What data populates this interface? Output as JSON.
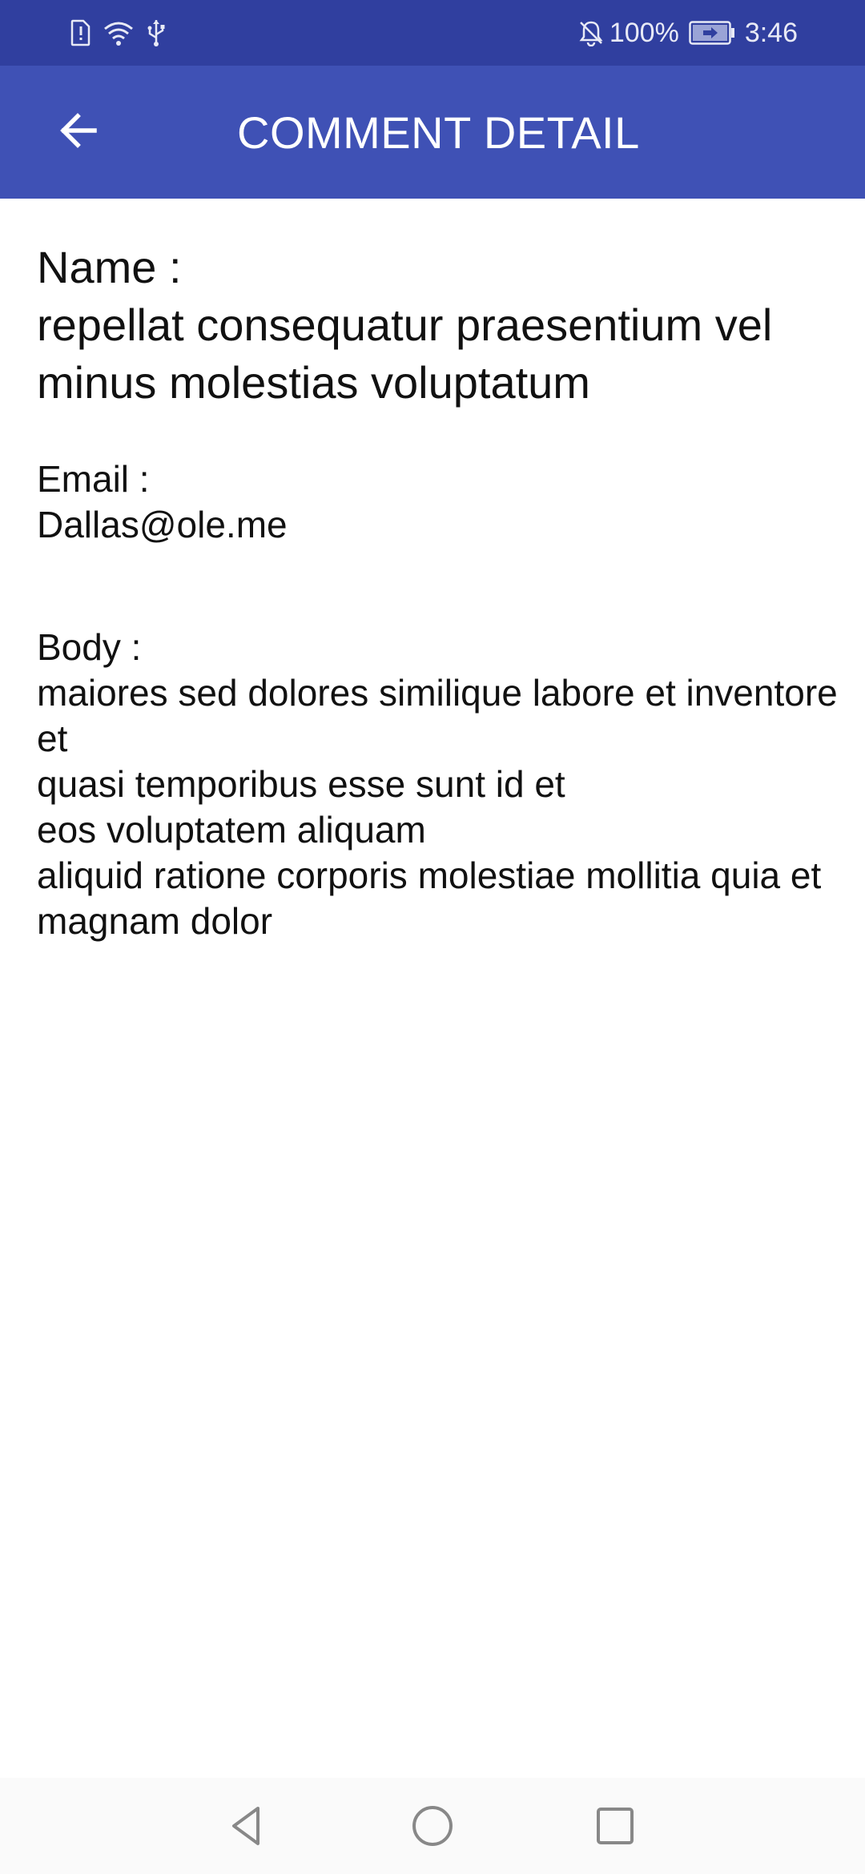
{
  "status_bar": {
    "battery": "100%",
    "time": "3:46",
    "icons": [
      "sim-alert-icon",
      "wifi-icon",
      "usb-icon",
      "notifications-off-icon",
      "battery-charging-icon"
    ]
  },
  "app_bar": {
    "title": "COMMENT DETAIL",
    "back_icon": "arrow-back-icon"
  },
  "comment": {
    "name_label": "Name :",
    "name_value": "repellat consequatur praesentium vel minus molestias voluptatum",
    "email_label": "Email :",
    "email_value": "Dallas@ole.me",
    "body_label": "Body :",
    "body_lines": [
      "maiores sed dolores similique labore et inventore et",
      "quasi temporibus esse sunt id et",
      "eos voluptatem aliquam",
      "aliquid ratione corporis molestiae mollitia quia et magnam dolor"
    ]
  },
  "nav_bar": {
    "icons": [
      "back-triangle-icon",
      "home-circle-icon",
      "recents-square-icon"
    ]
  },
  "colors": {
    "status_bar": "#303f9f",
    "app_bar": "#3f51b5",
    "nav_bar": "#fafafa",
    "text": "#111111"
  }
}
